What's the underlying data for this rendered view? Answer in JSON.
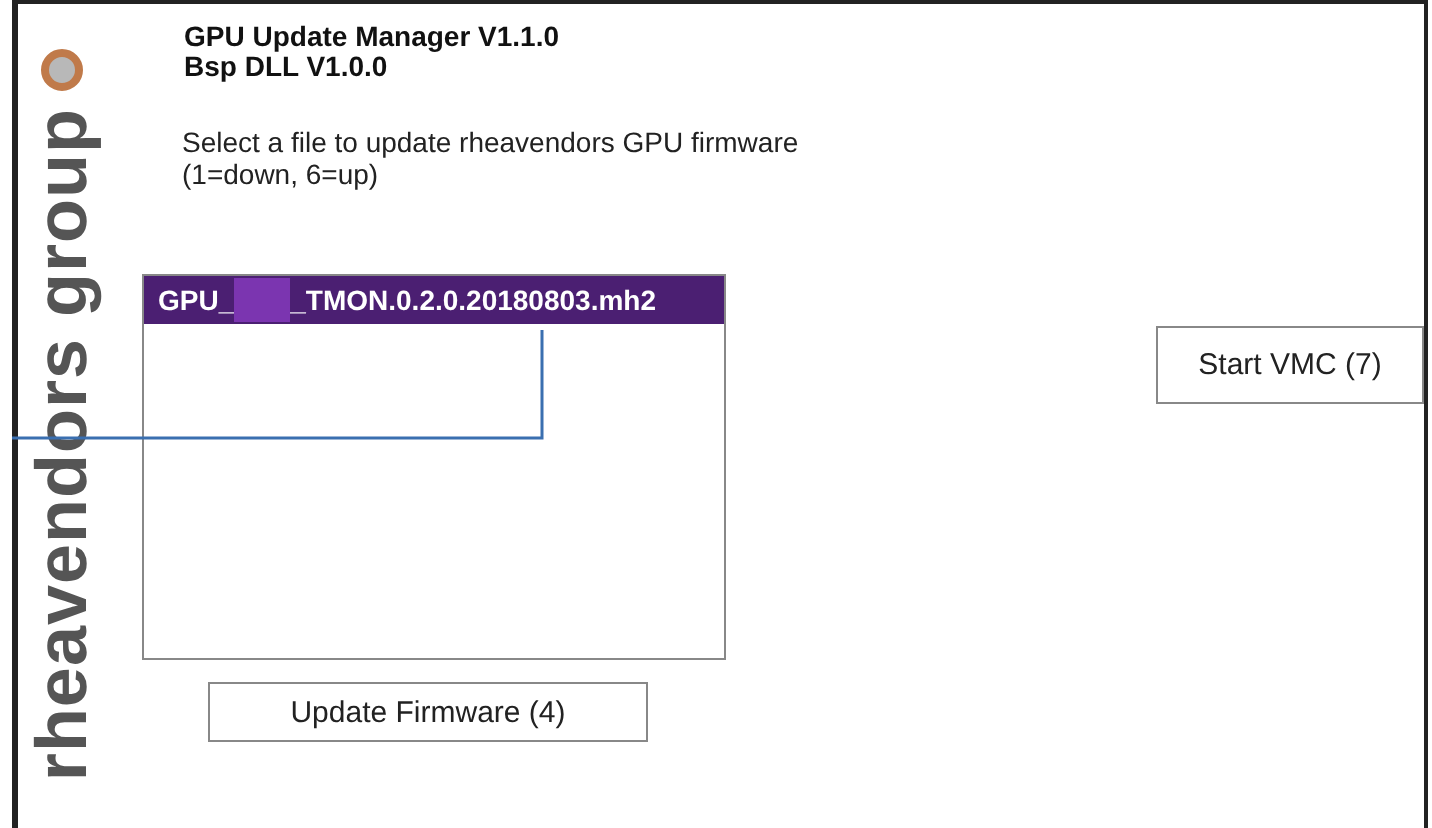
{
  "brand": {
    "name": "rheavendors group"
  },
  "header": {
    "title": "GPU Update Manager V1.1.0",
    "subtitle": "Bsp DLL V1.0.0"
  },
  "instruction": {
    "lines": [
      "Select a file to update rheavendors GPU firmware",
      "(1=down, 6=up)"
    ]
  },
  "file_list": {
    "items": [
      {
        "prefix": "GPU_",
        "suffix": "_TMON.0.2.0.20180803.mh2",
        "redacted": true,
        "selected": true
      }
    ]
  },
  "buttons": {
    "update": "Update Firmware (4)",
    "start": "Start VMC (7)"
  }
}
